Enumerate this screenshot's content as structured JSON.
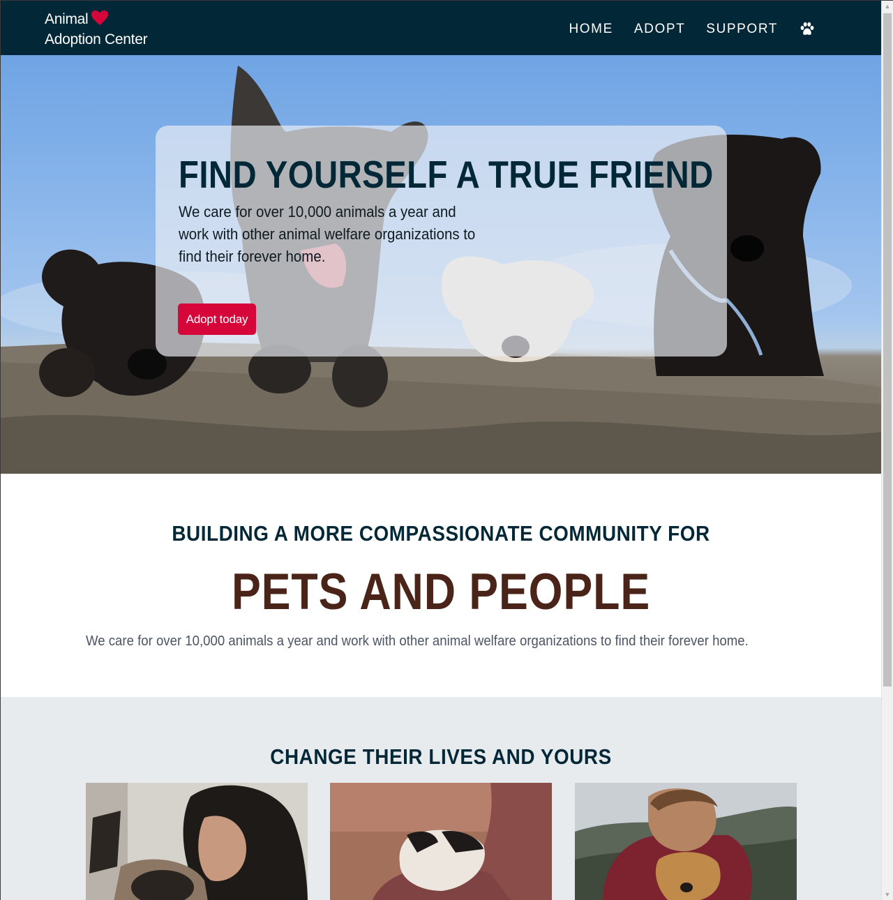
{
  "brand": {
    "line1": "Animal",
    "line2": "Adoption Center",
    "heart_icon": "heart-icon",
    "heart_color": "#d6063b"
  },
  "nav": {
    "items": [
      {
        "label": "HOME"
      },
      {
        "label": "ADOPT"
      },
      {
        "label": "SUPPORT"
      }
    ],
    "paw_icon": "paw-icon"
  },
  "hero": {
    "title": "FIND YOURSELF A TRUE FRIEND",
    "text": "We care for over 10,000 animals a year and work with other animal welfare organizations to find their forever home.",
    "button_label": "Adopt today",
    "button_color": "#d6063b"
  },
  "mission": {
    "subtitle": "BUILDING A MORE COMPASSIONATE COMMUNITY FOR",
    "title": "PETS AND PEOPLE",
    "text": "We care for over 10,000 animals a year and work with other animal welfare organizations to find their forever home."
  },
  "stories": {
    "title": "CHANGE THEIR LIVES AND YOURS"
  },
  "colors": {
    "navbar": "#022736",
    "accent": "#d6063b",
    "heading": "#022736",
    "mission_title": "#4a2418",
    "section_bg": "#e8ebee"
  }
}
